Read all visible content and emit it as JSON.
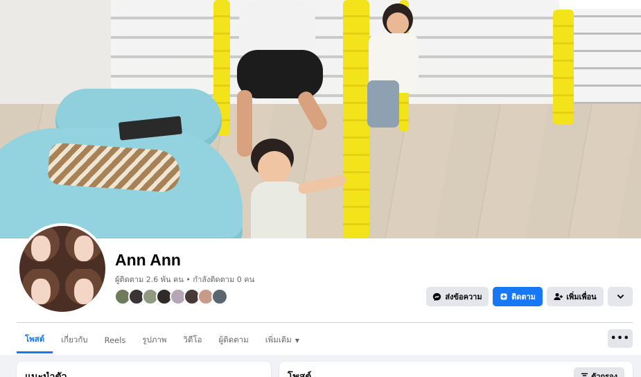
{
  "profile": {
    "name": "Ann Ann",
    "followers": "ผู้ติดตาม 2.6 พัน คน",
    "separator": " • ",
    "following": "กำลังติดตาม 0 คน"
  },
  "friend_avatars": [
    {
      "color": "#6d7a5c"
    },
    {
      "color": "#3b3434"
    },
    {
      "color": "#8f9a80"
    },
    {
      "color": "#2f2a28"
    },
    {
      "color": "#b5a7b6"
    },
    {
      "color": "#4a3a36"
    },
    {
      "color": "#c89a8a"
    },
    {
      "color": "#5c6670"
    }
  ],
  "actions": {
    "message": {
      "label": "ส่งข้อความ",
      "icon": "messenger-icon"
    },
    "follow": {
      "label": "ติดตาม",
      "icon": "follow-icon"
    },
    "add_friend": {
      "label": "เพิ่มเพื่อน",
      "icon": "add-friend-icon"
    },
    "dropdown": {
      "icon": "chevron-down-icon"
    }
  },
  "tabs": [
    {
      "label": "โพสต์",
      "active": true
    },
    {
      "label": "เกี่ยวกับ",
      "active": false
    },
    {
      "label": "Reels",
      "active": false
    },
    {
      "label": "รูปภาพ",
      "active": false
    },
    {
      "label": "วิดีโอ",
      "active": false
    },
    {
      "label": "ผู้ติดตาม",
      "active": false
    },
    {
      "label": "เพิ่มเติม",
      "active": false,
      "icon": "caret-down-icon"
    }
  ],
  "more_button": {
    "label": "•••"
  },
  "cards": {
    "intro_title": "แนะนำตัว",
    "posts_title": "โพสต์",
    "filter_label": "ตัวกรอง",
    "filter_icon": "filter-icon"
  },
  "colors": {
    "accent": "#1877f2",
    "button_gray": "#e4e6eb",
    "secondary_text": "#65676b"
  }
}
